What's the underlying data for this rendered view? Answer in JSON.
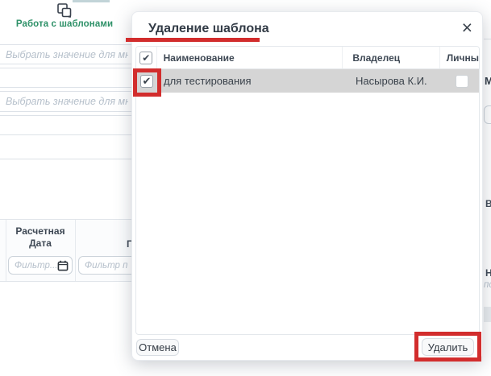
{
  "icons": {
    "check": "✔",
    "close": "×"
  },
  "colors": {
    "annotation_red": "#d22d2d",
    "accent_green": "#2e9168",
    "selected_row_bg": "#d5d5d5"
  },
  "background": {
    "templates_button_label": "Работа с шаблонами",
    "multiselect_placeholder": "Выбрать значение для множ",
    "filter_table": {
      "date_column_header": "Расчетная Дата",
      "date_filter_placeholder": "Фильтр...",
      "next_column_header_fragment": "П",
      "text_filter_placeholder": "Фильтр по"
    },
    "right_edge_fragments": {
      "label_top": "М",
      "label_mid": "В",
      "label_lower": "Н",
      "placeholder_fragment": "по"
    }
  },
  "modal": {
    "title": "Удаление шаблона",
    "table": {
      "columns": {
        "name": "Наименование",
        "owner": "Владелец",
        "personal": "Личны"
      },
      "row": {
        "name": "для тестирования",
        "owner": "Насырова К.И."
      }
    },
    "cancel_label": "Отмена",
    "delete_label": "Удалить"
  }
}
